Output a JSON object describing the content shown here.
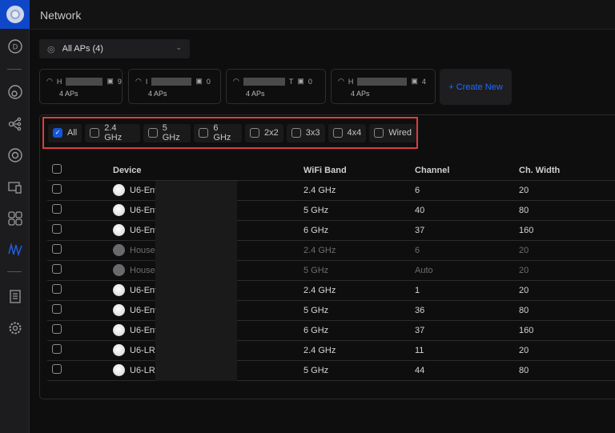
{
  "header": {
    "title": "Network"
  },
  "sidebar": {
    "items": [
      "dashboard-icon",
      "topology-icon",
      "clients-icon",
      "unifi-devices-icon",
      "client-devices-icon",
      "insights-icon",
      "wifiman-icon",
      "system-log-icon",
      "settings-icon"
    ],
    "active": "wifiman-icon",
    "accent": "#1556d6"
  },
  "ap_select": {
    "label": "All APs (4)"
  },
  "ap_groups": [
    {
      "prefix": "H",
      "count": "9",
      "aps": "4 APs"
    },
    {
      "prefix": "I",
      "count": "0",
      "aps": "4 APs"
    },
    {
      "prefix": "T",
      "count": "0",
      "aps": "4 APs"
    },
    {
      "prefix": "H",
      "count": "4",
      "aps": "4 APs"
    }
  ],
  "create_new": "+ Create New",
  "filters": [
    {
      "label": "All",
      "checked": true
    },
    {
      "label": "2.4 GHz"
    },
    {
      "label": "5 GHz"
    },
    {
      "label": "6 GHz"
    },
    {
      "label": "2x2"
    },
    {
      "label": "3x3"
    },
    {
      "label": "4x4"
    },
    {
      "label": "Wired"
    }
  ],
  "table": {
    "headers": [
      "Device",
      "WiFi Band",
      "Channel",
      "Ch. Width"
    ],
    "rows": [
      {
        "device": "U6-Ent",
        "band": "2.4 GHz",
        "channel": "6",
        "width": "20"
      },
      {
        "device": "U6-Ent",
        "band": "5 GHz",
        "channel": "40",
        "width": "80"
      },
      {
        "device": "U6-Ent",
        "band": "6 GHz",
        "channel": "37",
        "width": "160"
      },
      {
        "device": "House",
        "band": "2.4 GHz",
        "channel": "6",
        "width": "20",
        "offline": true
      },
      {
        "device": "House",
        "band": "5 GHz",
        "channel": "Auto",
        "width": "20",
        "offline": true
      },
      {
        "device": "U6-Ent",
        "band": "2.4 GHz",
        "channel": "1",
        "width": "20"
      },
      {
        "device": "U6-Ent",
        "band": "5 GHz",
        "channel": "36",
        "width": "80"
      },
      {
        "device": "U6-Ent",
        "band": "6 GHz",
        "channel": "37",
        "width": "160"
      },
      {
        "device": "U6-LR",
        "band": "2.4 GHz",
        "channel": "11",
        "width": "20"
      },
      {
        "device": "U6-LR",
        "band": "5 GHz",
        "channel": "44",
        "width": "80"
      }
    ]
  }
}
